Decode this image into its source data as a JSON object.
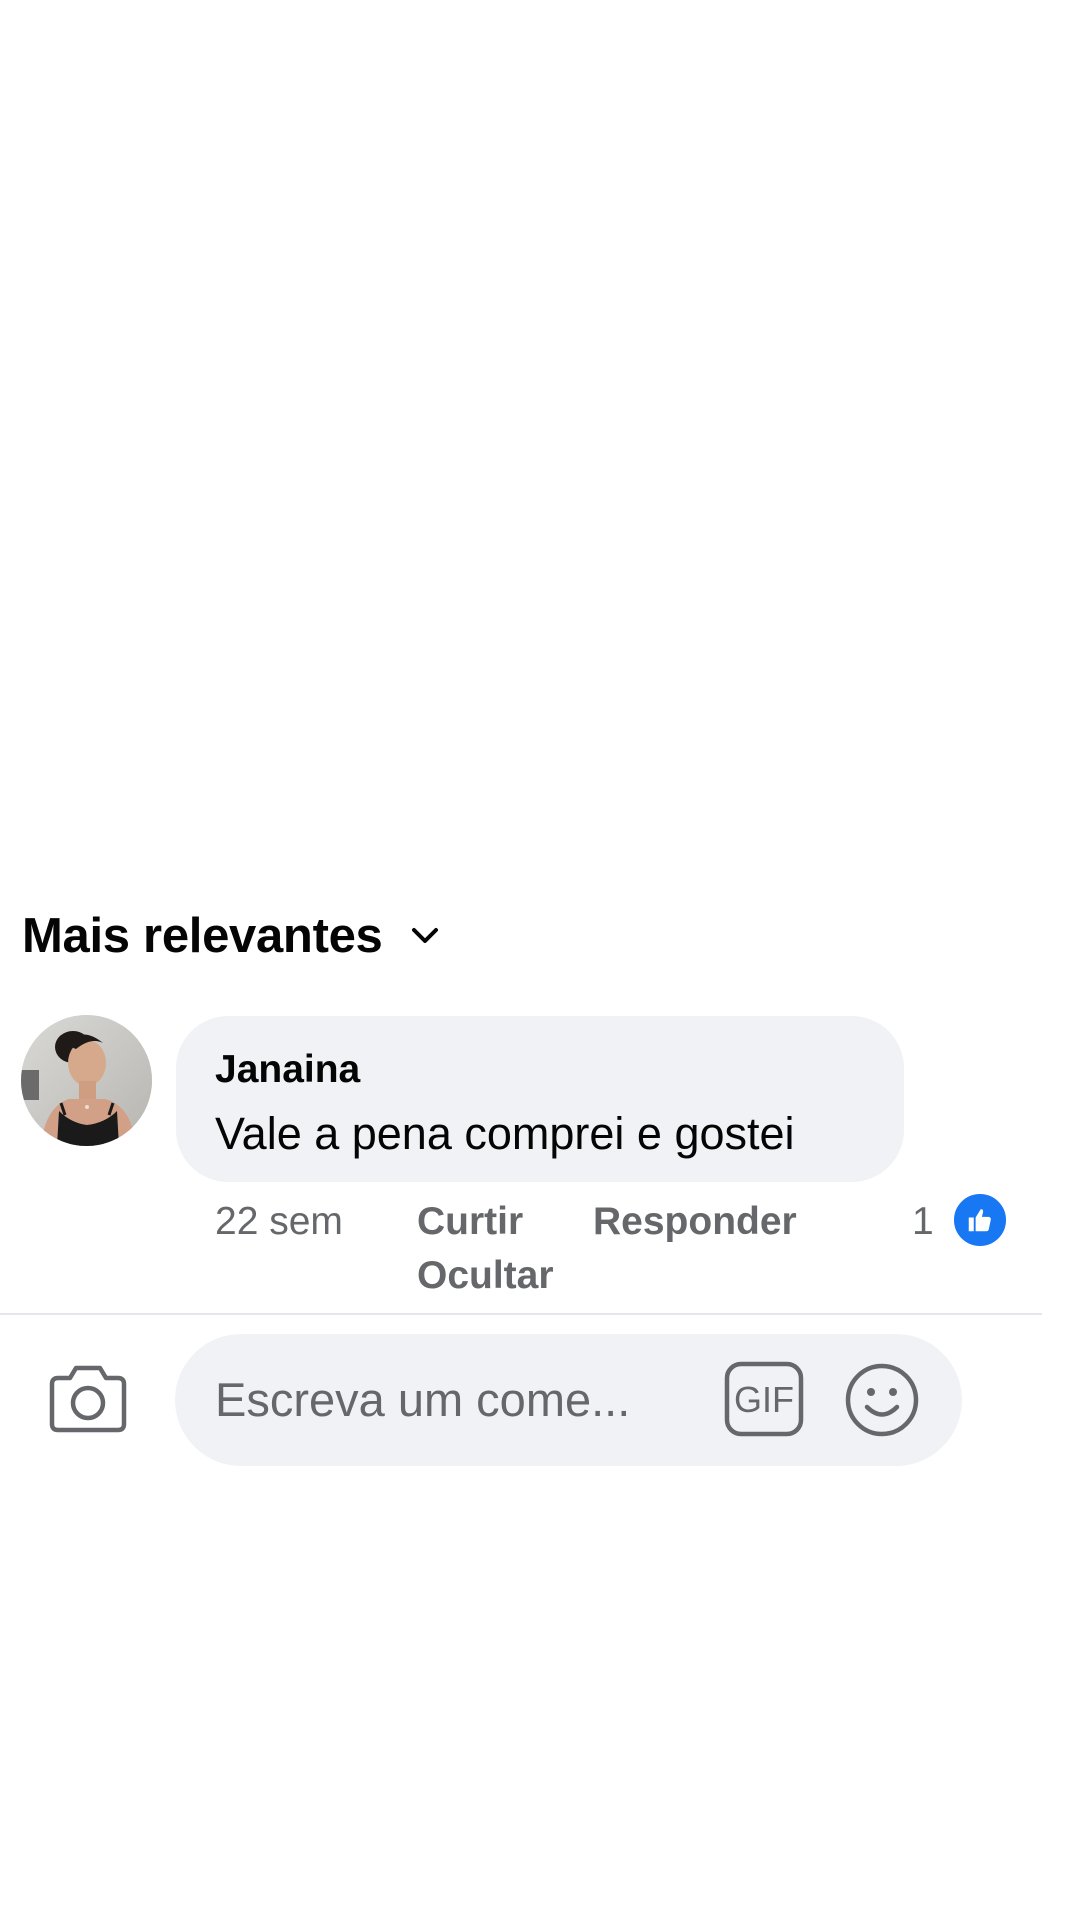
{
  "sort": {
    "label": "Mais relevantes",
    "icon": "chevron-down-icon"
  },
  "comment": {
    "author": "Janaina",
    "text": "Vale a pena comprei e gostei",
    "timestamp": "22 sem",
    "like_label": "Curtir",
    "reply_label": "Responder",
    "hide_label": "Ocultar",
    "reaction_count": "1",
    "reaction_icon": "like-thumb-icon",
    "reaction_color": "#1877f2"
  },
  "composer": {
    "placeholder": "Escreva um come...",
    "camera_icon": "camera-icon",
    "gif_label": "GIF",
    "emoji_icon": "smiley-icon"
  },
  "colors": {
    "bubble_bg": "#f0f2f5",
    "secondary_text": "#65676b",
    "primary_text": "#050505",
    "accent": "#1877f2"
  }
}
